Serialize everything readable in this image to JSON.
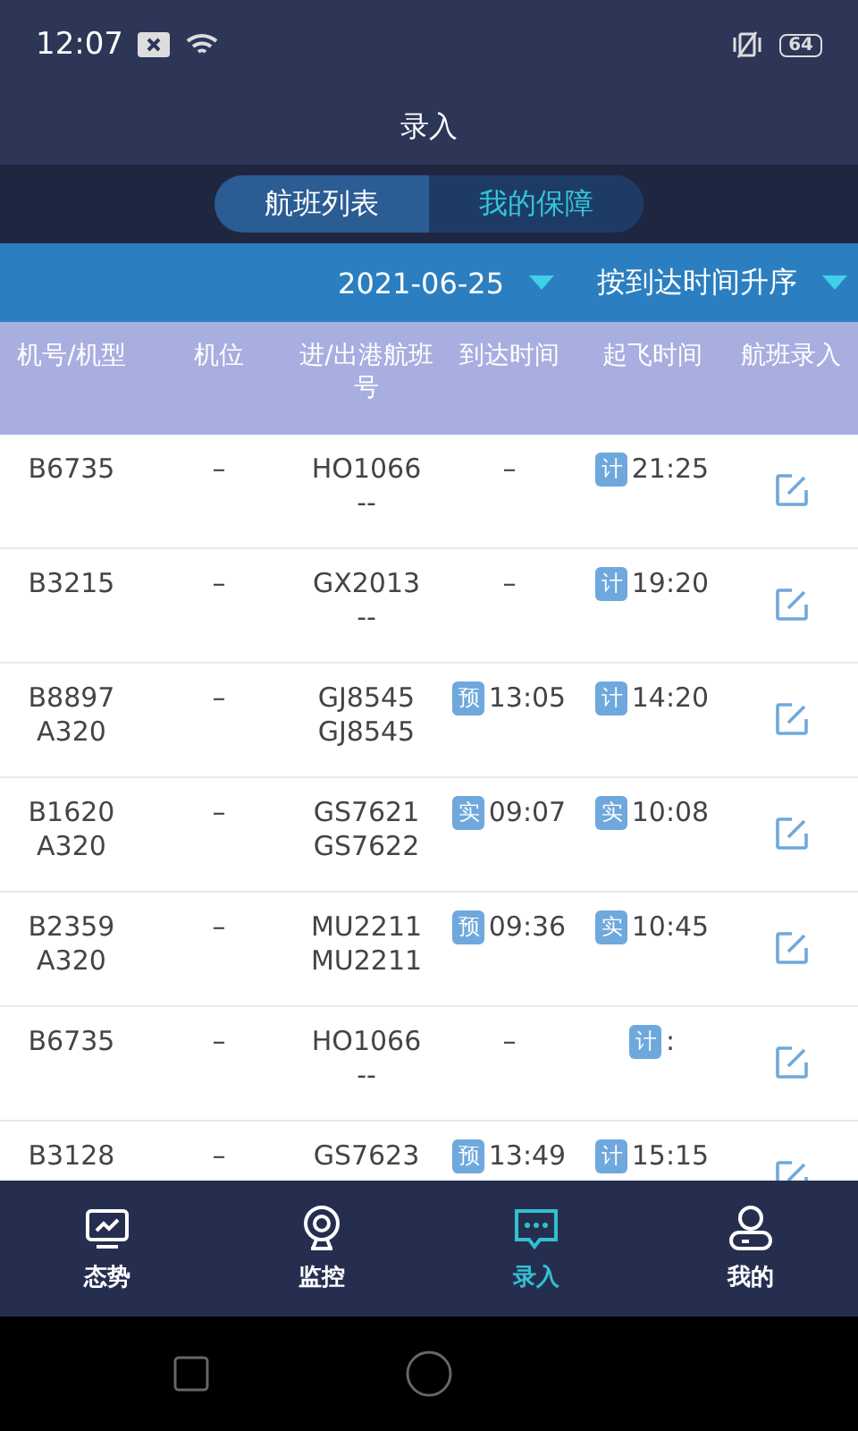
{
  "status_bar": {
    "time": "12:07",
    "battery": "64"
  },
  "title": "录入",
  "segments": [
    {
      "label": "航班列表",
      "selected": true
    },
    {
      "label": "我的保障",
      "selected": false
    }
  ],
  "filters": [
    {
      "value": "2021-06-25"
    },
    {
      "value": "按到达时间升序"
    }
  ],
  "columns": [
    "机号/机型",
    "机位",
    "进/出港航班号",
    "到达时间",
    "起飞时间",
    "航班录入"
  ],
  "rows": [
    {
      "aircraft": [
        "B6735"
      ],
      "stand": "–",
      "flights": [
        "HO1066",
        "--"
      ],
      "arrival": {
        "time": "–"
      },
      "departure": {
        "tag": "计",
        "time": "21:25"
      }
    },
    {
      "aircraft": [
        "B3215"
      ],
      "stand": "–",
      "flights": [
        "GX2013",
        "--"
      ],
      "arrival": {
        "time": "–"
      },
      "departure": {
        "tag": "计",
        "time": "19:20"
      }
    },
    {
      "aircraft": [
        "B8897",
        "A320"
      ],
      "stand": "–",
      "flights": [
        "GJ8545",
        "GJ8545"
      ],
      "arrival": {
        "tag": "预",
        "time": "13:05"
      },
      "departure": {
        "tag": "计",
        "time": "14:20"
      }
    },
    {
      "aircraft": [
        "B1620",
        "A320"
      ],
      "stand": "–",
      "flights": [
        "GS7621",
        "GS7622"
      ],
      "arrival": {
        "tag": "实",
        "time": "09:07"
      },
      "departure": {
        "tag": "实",
        "time": "10:08"
      }
    },
    {
      "aircraft": [
        "B2359",
        "A320"
      ],
      "stand": "–",
      "flights": [
        "MU2211",
        "MU2211"
      ],
      "arrival": {
        "tag": "预",
        "time": "09:36"
      },
      "departure": {
        "tag": "实",
        "time": "10:45"
      }
    },
    {
      "aircraft": [
        "B6735"
      ],
      "stand": "–",
      "flights": [
        "HO1066",
        "--"
      ],
      "arrival": {
        "time": "–"
      },
      "departure": {
        "tag": "计",
        "time": ":"
      }
    },
    {
      "aircraft": [
        "B3128"
      ],
      "stand": "–",
      "flights": [
        "GS7623"
      ],
      "arrival": {
        "tag": "预",
        "time": "13:49"
      },
      "departure": {
        "tag": "计",
        "time": "15:15"
      }
    }
  ],
  "nav": [
    {
      "kind": "monitor",
      "label": "态势",
      "selected": false
    },
    {
      "kind": "camera",
      "label": "监控",
      "selected": false
    },
    {
      "kind": "chat",
      "label": "录入",
      "selected": true
    },
    {
      "kind": "user",
      "label": "我的",
      "selected": false
    }
  ]
}
